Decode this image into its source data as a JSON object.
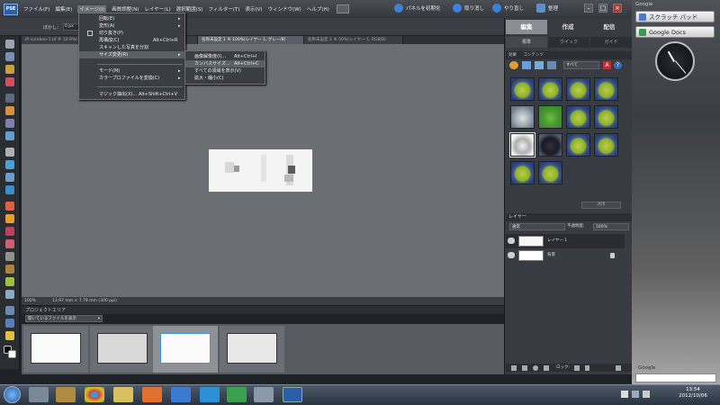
{
  "menubar": {
    "logo": "PSE",
    "items": [
      "ファイル(F)",
      "編集(E)",
      "イメージ(I)",
      "画質調整(N)",
      "レイヤー(L)",
      "選択範囲(S)",
      "フィルター(T)",
      "表示(V)",
      "ウィンドウ(W)",
      "ヘルプ(H)"
    ],
    "right": {
      "panel_reset": "パネルを初期化",
      "undo": "取り消し",
      "redo": "やり直し",
      "organize": "整理"
    }
  },
  "options": {
    "feather_label": "ぼかし：",
    "feather_value": "0 px"
  },
  "doc_tabs": [
    "IP noreboe-1.tif ® 10.9%(グレー/8)",
    "名称未設定 1 ® 100%(レイヤー 1, グレー/8)",
    "名称未設定 2 ® 50%(レイヤー 1, RGB/8)"
  ],
  "image_menu": {
    "items": [
      {
        "label": "回転(E)",
        "shortcut": "",
        "submenu": true
      },
      {
        "label": "変形(A)",
        "shortcut": "",
        "submenu": true
      },
      {
        "label": "切り抜き(P)",
        "shortcut": "",
        "submenu": false
      },
      {
        "label": "再構成(C)",
        "shortcut": "Alt+Ctrl+R",
        "submenu": false
      },
      {
        "label": "スキャンした写真を分割",
        "shortcut": "",
        "submenu": false
      },
      {
        "label": "サイズ変更(R)",
        "shortcut": "",
        "submenu": true
      },
      {
        "label": "モード(M)",
        "shortcut": "",
        "submenu": true
      },
      {
        "label": "カラープロファイルを変換(C)",
        "shortcut": "",
        "submenu": true
      },
      {
        "label": "マジック抽出(X)...",
        "shortcut": "Alt+Shift+Ctrl+V",
        "submenu": false
      }
    ]
  },
  "resize_menu": {
    "items": [
      {
        "label": "画像解像度(I)...",
        "shortcut": "Alt+Ctrl+I"
      },
      {
        "label": "カンバスサイズ...",
        "shortcut": "Alt+Ctrl+C"
      },
      {
        "label": "すべての領域を表示(V)",
        "shortcut": ""
      },
      {
        "label": "拡大・縮小(C)",
        "shortcut": ""
      }
    ]
  },
  "status": {
    "zoom": "100%",
    "doc_size": "13.97 mm × 7.79 mm (300 ppi)"
  },
  "project_bin": {
    "title": "プロジェクトエリア",
    "filter": "開いているファイルを表示"
  },
  "right_panel": {
    "mode_tabs": [
      "編集",
      "作成",
      "配信"
    ],
    "sub_tabs": [
      "標準",
      "クイック",
      "ガイド"
    ],
    "effects_strip": [
      "効果",
      "コンテンツ"
    ],
    "effects_filter": "すべて",
    "apply_button": "適用",
    "layers_title": "レイヤー",
    "blend_mode": "通常",
    "opacity_label": "不透明度:",
    "opacity_value": "100%",
    "layers": [
      {
        "name": "レイヤー 1"
      },
      {
        "name": "背景"
      }
    ],
    "lock_label": "ロック:"
  },
  "gadgets": {
    "google_label": "Google",
    "scratchpad": "スクラッチ パッド",
    "docs": "Google Docs",
    "search_label": "Google"
  },
  "tray": {
    "time": "13:54",
    "date": "2012/10/06"
  },
  "colors": {
    "accent": "#4a90e0",
    "highlight": "#5a6068"
  }
}
